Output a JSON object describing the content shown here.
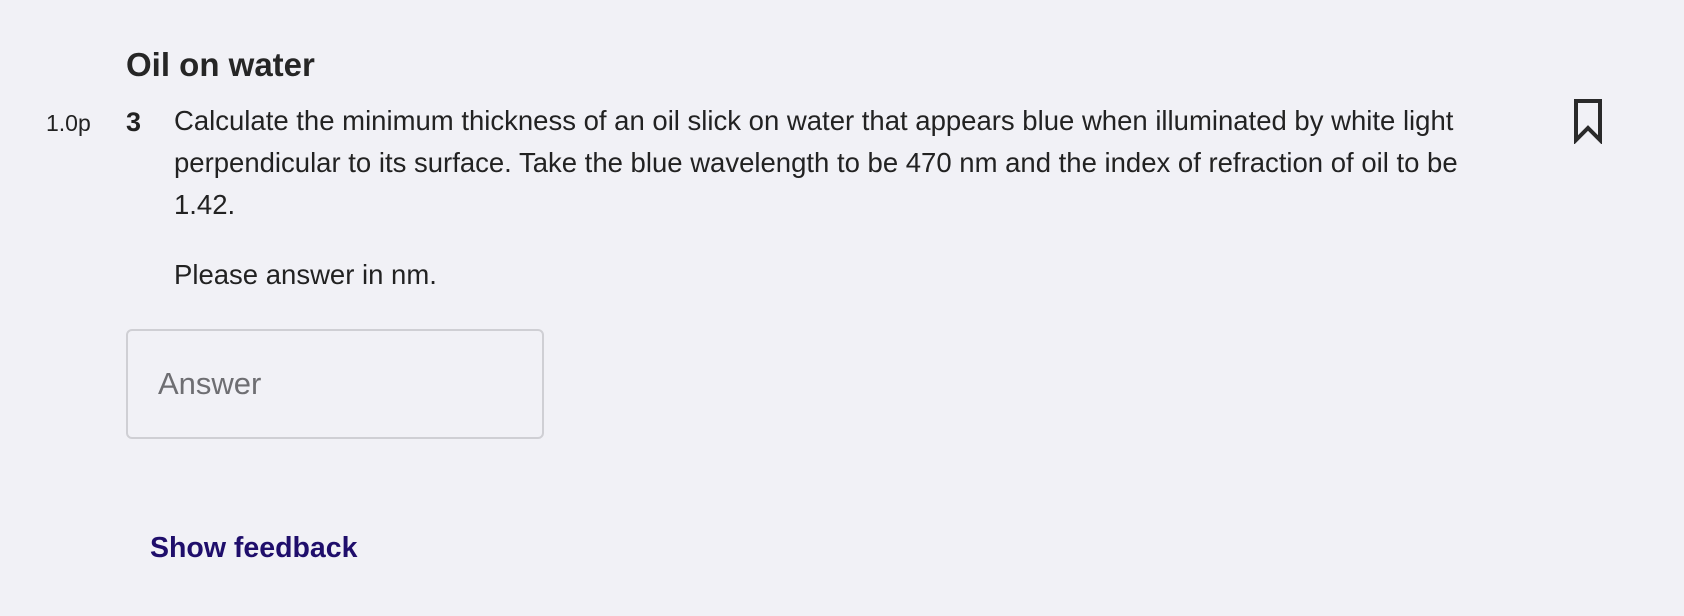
{
  "question": {
    "title": "Oil on water",
    "points": "1.0p",
    "number": "3",
    "text": "Calculate the minimum thickness of an oil slick on water that appears blue when illuminated by white light perpendicular to its surface. Take the blue wavelength to be 470 nm and the index of refraction of oil to be 1.42.",
    "instruction": "Please answer in nm.",
    "bookmark_icon": "bookmark-icon"
  },
  "answer": {
    "placeholder": "Answer",
    "value": ""
  },
  "feedback": {
    "label": "Show feedback",
    "color": "#1f0e6b"
  },
  "colors": {
    "background": "#f1f1f6",
    "text": "#222222",
    "input_border": "#cfcfd4"
  }
}
